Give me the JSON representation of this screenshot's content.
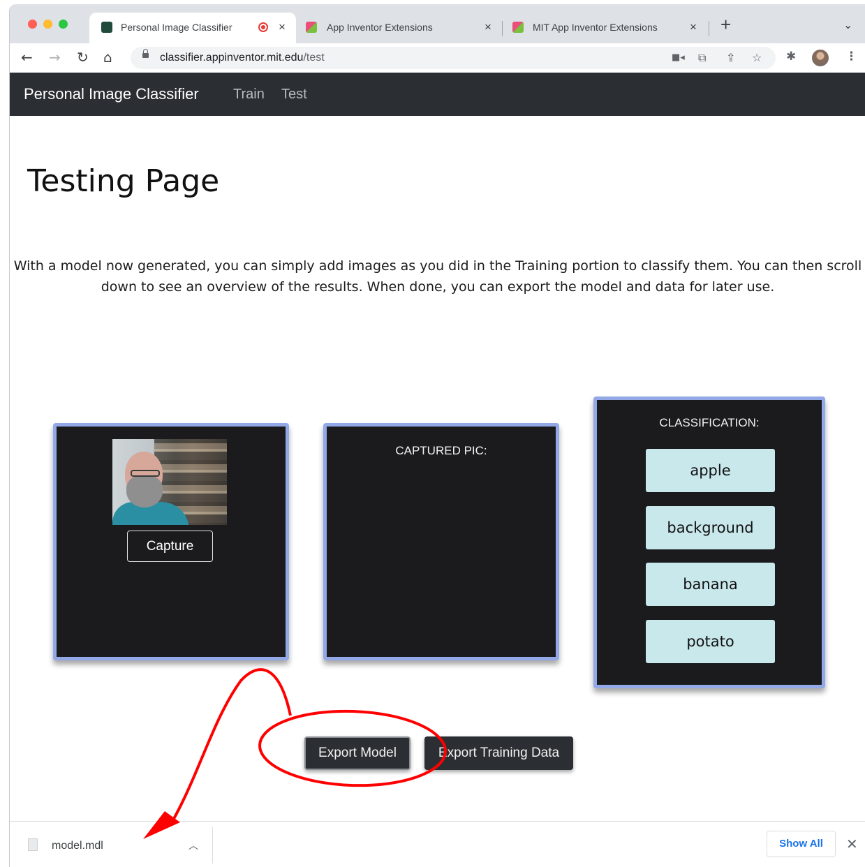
{
  "browser": {
    "tabs": [
      {
        "title": "Personal Image Classifier",
        "active": true,
        "recording": true
      },
      {
        "title": "App Inventor Extensions",
        "active": false
      },
      {
        "title": "MIT App Inventor Extensions",
        "active": false
      }
    ],
    "close_glyph": "×",
    "new_tab_glyph": "+",
    "tab_menu_glyph": "⌄",
    "url_host": "classifier.appinventor.mit.edu",
    "url_path": "/test",
    "toolbar_icons": [
      "back-icon",
      "forward-icon",
      "reload-icon",
      "home-icon",
      "lock-icon",
      "camera-icon",
      "translate-icon",
      "share-icon",
      "star-icon",
      "extensions-icon",
      "profile-avatar",
      "menu-icon"
    ]
  },
  "navbar": {
    "brand": "Personal Image Classifier",
    "links": [
      "Train",
      "Test"
    ]
  },
  "main": {
    "heading": "Testing Page",
    "description": "With a model now generated, you can simply add images as you did in the Training portion to classify them. You can then scroll down to see an overview of the results. When done, you can export the model and data for later use.",
    "capture_label": "Capture",
    "captured_pic_label": "CAPTURED PIC:",
    "classification_label": "CLASSIFICATION:",
    "classes": [
      "apple",
      "background",
      "banana",
      "potato"
    ],
    "export_model_label": "Export Model",
    "export_training_label": "Export Training Data"
  },
  "download_shelf": {
    "filename": "model.mdl",
    "show_all_label": "Show All",
    "close_glyph": "✕"
  },
  "colors": {
    "card_border": "#93a8e6",
    "card_bg": "#1b1b1d",
    "class_button_bg": "#c9e8ec",
    "navbar_bg": "#2b2f33",
    "annotation_red": "#ff0000"
  }
}
